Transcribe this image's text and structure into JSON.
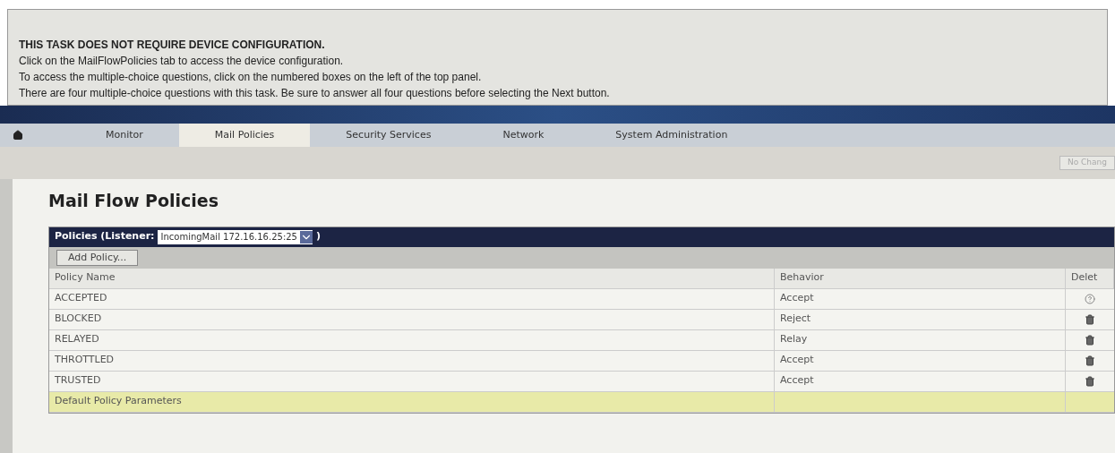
{
  "instructions": {
    "heading": "THIS TASK DOES NOT REQUIRE DEVICE CONFIGURATION.",
    "lines": [
      "Click on the MailFlowPolicies tab to access the device configuration.",
      "To access the multiple-choice questions, click on the numbered boxes on the left of the top panel.",
      "There are four multiple-choice questions with this task. Be sure to answer all four questions before selecting the Next button."
    ]
  },
  "nav": {
    "tabs": [
      {
        "label": "Monitor",
        "selected": false
      },
      {
        "label": "Mail Policies",
        "selected": true
      },
      {
        "label": "Security Services",
        "selected": false
      },
      {
        "label": "Network",
        "selected": false
      },
      {
        "label": "System Administration",
        "selected": false
      }
    ]
  },
  "commit_button": "No Chang",
  "page_title": "Mail Flow Policies",
  "panel": {
    "title": "Policies (Listener:",
    "listener": "IncomingMail 172.16.16.25:25",
    "title_end": ")",
    "add_button": "Add Policy...",
    "columns": [
      "Policy Name",
      "Behavior",
      "Delet"
    ],
    "rows": [
      {
        "name": "ACCEPTED",
        "behavior": "Accept",
        "kind": "help"
      },
      {
        "name": "BLOCKED",
        "behavior": "Reject",
        "kind": "delete"
      },
      {
        "name": "RELAYED",
        "behavior": "Relay",
        "kind": "delete"
      },
      {
        "name": "THROTTLED",
        "behavior": "Accept",
        "kind": "delete"
      },
      {
        "name": "TRUSTED",
        "behavior": "Accept",
        "kind": "delete"
      },
      {
        "name": "Default Policy Parameters",
        "kind": "parameters"
      }
    ]
  }
}
